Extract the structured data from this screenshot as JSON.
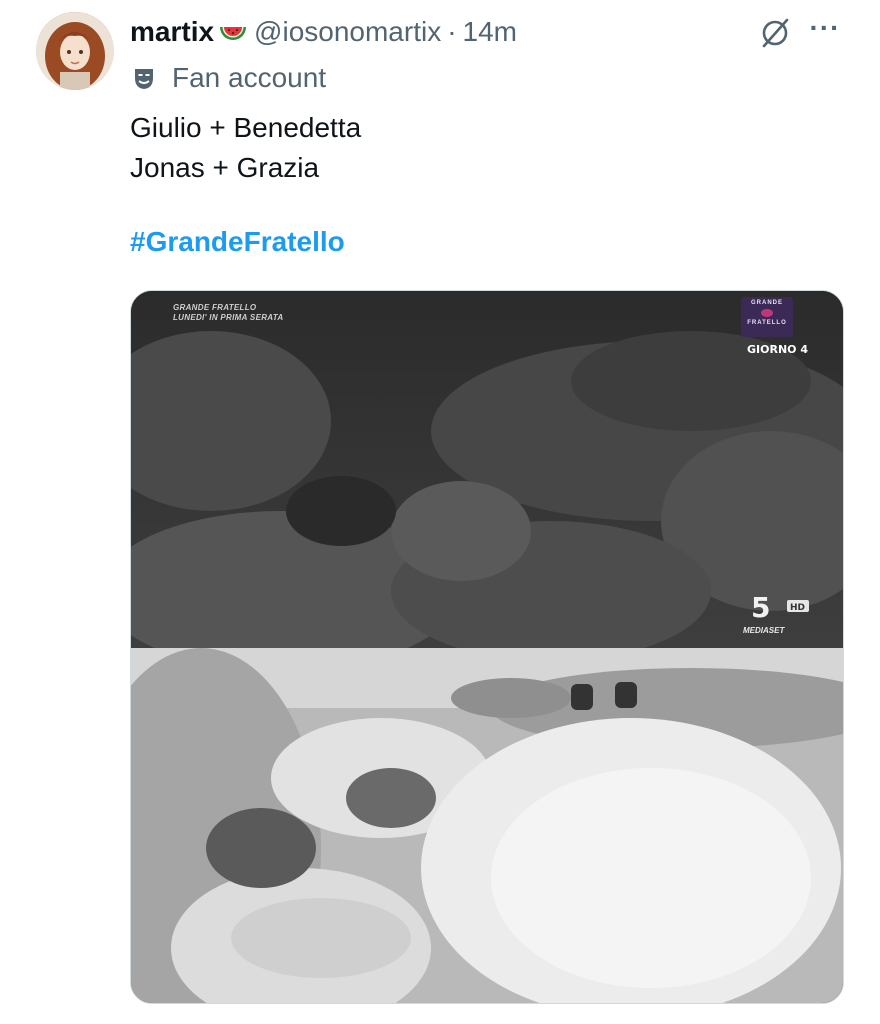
{
  "post": {
    "display_name": "martix",
    "name_emoji": "watermelon-emoji",
    "handle": "@iosonomartix",
    "separator": "·",
    "time": "14m",
    "label": "Fan account",
    "label_icon": "theater-mask-icon",
    "text_lines": [
      "Giulio + Benedetta",
      "Jonas + Grazia"
    ],
    "hashtag": "#GrandeFratello"
  },
  "actions": {
    "grok_icon": "grok-icon",
    "more_icon": "more-icon",
    "more_label": "···"
  },
  "media": {
    "overlay_title_line1": "GRANDE FRATELLO",
    "overlay_title_line2": "LUNEDI' IN PRIMA SERATA",
    "logo_line1": "GRANDE",
    "logo_line2": "FRATELLO",
    "day_label": "GIORNO 4",
    "channel_hd": "HD",
    "channel_label": "MEDIASET"
  },
  "colors": {
    "accent": "#1d9bf0",
    "secondary_text": "#536471",
    "primary_text": "#0f1419"
  }
}
